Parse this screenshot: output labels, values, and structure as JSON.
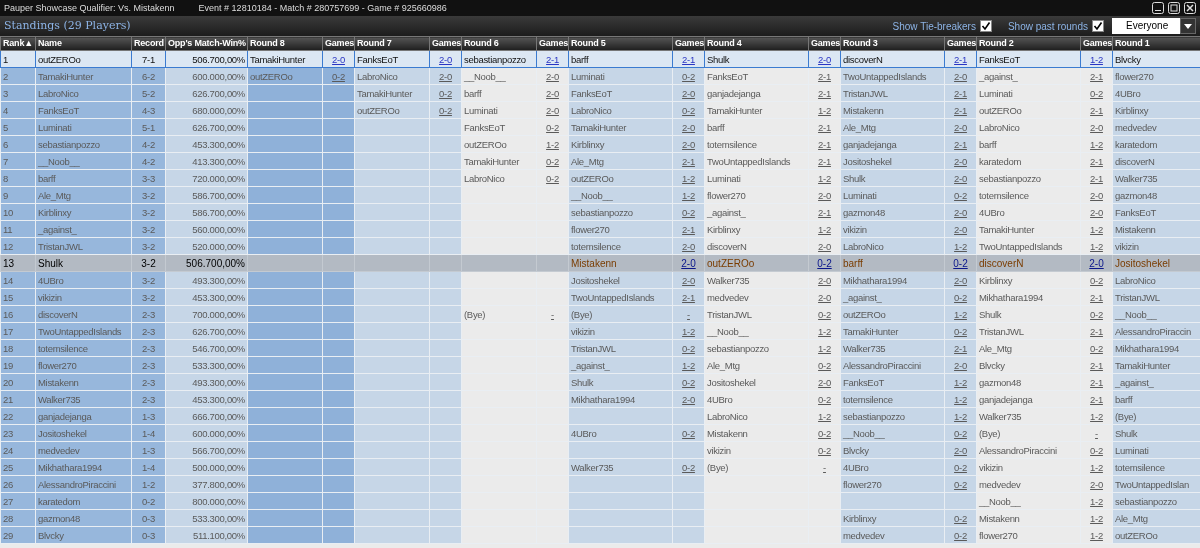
{
  "window": {
    "title": "Pauper Showcase Qualifier: Vs. Mistakenn",
    "subtitle": "Event # 12810184 - Match # 280757699 - Game # 925660986"
  },
  "standings": {
    "title": "Standings (29 Players)",
    "options": [
      {
        "label": "Show Tie-breakers",
        "checked": true
      },
      {
        "label": "Show past rounds",
        "checked": true
      }
    ],
    "filter": "Everyone"
  },
  "columns": [
    {
      "label": "Rank",
      "sort_mark": "▲"
    },
    {
      "label": "Name"
    },
    {
      "label": "Record"
    },
    {
      "label": "Opp's Match-Win%"
    },
    {
      "label": "Round 8"
    },
    {
      "label": "Games"
    },
    {
      "label": "Round 7"
    },
    {
      "label": "Games"
    },
    {
      "label": "Round 6"
    },
    {
      "label": "Games"
    },
    {
      "label": "Round 5"
    },
    {
      "label": "Games"
    },
    {
      "label": "Round 4"
    },
    {
      "label": "Games"
    },
    {
      "label": "Round 3"
    },
    {
      "label": "Games"
    },
    {
      "label": "Round 2"
    },
    {
      "label": "Games"
    },
    {
      "label": "Round 1"
    }
  ],
  "rows": [
    {
      "rank": "1",
      "name": "outZEROo",
      "record": "7-1",
      "omw": "506.700,00%",
      "selected": false,
      "outlined": true,
      "rounds": {
        "round_8": {
          "opponent": "TamakiHunter",
          "games": "2-0"
        },
        "round_7": {
          "opponent": "FanksEoT",
          "games": "2-0"
        },
        "round_6": {
          "opponent": "sebastianpozzo",
          "games": "2-1"
        },
        "round_5": {
          "opponent": "barff",
          "games": "2-1"
        },
        "round_4": {
          "opponent": "Shulk",
          "games": "2-0"
        },
        "round_3": {
          "opponent": "discoverN",
          "games": "2-1"
        },
        "round_2": {
          "opponent": "FanksEoT",
          "games": "1-2"
        },
        "round_1": {
          "opponent": "Blvcky"
        }
      }
    },
    {
      "rank": "2",
      "name": "TamakiHunter",
      "record": "6-2",
      "omw": "600.000,00%",
      "selected": false,
      "outlined": false,
      "rounds": {
        "round_8": {
          "opponent": "outZEROo",
          "games": "0-2"
        },
        "round_7": {
          "opponent": "LabroNico",
          "games": "2-0"
        },
        "round_6": {
          "opponent": "__Noob__",
          "games": "2-0"
        },
        "round_5": {
          "opponent": "Luminati",
          "games": "0-2"
        },
        "round_4": {
          "opponent": "FanksEoT",
          "games": "2-1"
        },
        "round_3": {
          "opponent": "TwoUntappedIslands",
          "games": "2-0"
        },
        "round_2": {
          "opponent": "_against_",
          "games": "2-1"
        },
        "round_1": {
          "opponent": "flower270"
        }
      }
    },
    {
      "rank": "3",
      "name": "LabroNico",
      "record": "5-2",
      "omw": "626.700,00%",
      "selected": false,
      "outlined": false,
      "rounds": {
        "round_7": {
          "opponent": "TamakiHunter",
          "games": "0-2"
        },
        "round_6": {
          "opponent": "barff",
          "games": "2-0"
        },
        "round_5": {
          "opponent": "FanksEoT",
          "games": "2-0"
        },
        "round_4": {
          "opponent": "ganjadejanga",
          "games": "2-1"
        },
        "round_3": {
          "opponent": "TristanJWL",
          "games": "2-1"
        },
        "round_2": {
          "opponent": "Luminati",
          "games": "0-2"
        },
        "round_1": {
          "opponent": "4UBro"
        }
      }
    },
    {
      "rank": "4",
      "name": "FanksEoT",
      "record": "4-3",
      "omw": "680.000,00%",
      "selected": false,
      "outlined": false,
      "rounds": {
        "round_7": {
          "opponent": "outZEROo",
          "games": "0-2"
        },
        "round_6": {
          "opponent": "Luminati",
          "games": "2-0"
        },
        "round_5": {
          "opponent": "LabroNico",
          "games": "0-2"
        },
        "round_4": {
          "opponent": "TamakiHunter",
          "games": "1-2"
        },
        "round_3": {
          "opponent": "Mistakenn",
          "games": "2-1"
        },
        "round_2": {
          "opponent": "outZEROo",
          "games": "2-1"
        },
        "round_1": {
          "opponent": "Kirblinxy"
        }
      }
    },
    {
      "rank": "5",
      "name": "Luminati",
      "record": "5-1",
      "omw": "626.700,00%",
      "selected": false,
      "outlined": false,
      "rounds": {
        "round_6": {
          "opponent": "FanksEoT",
          "games": "0-2"
        },
        "round_5": {
          "opponent": "TamakiHunter",
          "games": "2-0"
        },
        "round_4": {
          "opponent": "barff",
          "games": "2-1"
        },
        "round_3": {
          "opponent": "Ale_Mtg",
          "games": "2-0"
        },
        "round_2": {
          "opponent": "LabroNico",
          "games": "2-0"
        },
        "round_1": {
          "opponent": "medvedev"
        }
      }
    },
    {
      "rank": "6",
      "name": "sebastianpozzo",
      "record": "4-2",
      "omw": "453.300,00%",
      "selected": false,
      "outlined": false,
      "rounds": {
        "round_6": {
          "opponent": "outZEROo",
          "games": "1-2"
        },
        "round_5": {
          "opponent": "Kirblinxy",
          "games": "2-0"
        },
        "round_4": {
          "opponent": "totemsilence",
          "games": "2-1"
        },
        "round_3": {
          "opponent": "ganjadejanga",
          "games": "2-1"
        },
        "round_2": {
          "opponent": "barff",
          "games": "1-2"
        },
        "round_1": {
          "opponent": "karatedom"
        }
      }
    },
    {
      "rank": "7",
      "name": "__Noob__",
      "record": "4-2",
      "omw": "413.300,00%",
      "selected": false,
      "outlined": false,
      "rounds": {
        "round_6": {
          "opponent": "TamakiHunter",
          "games": "0-2"
        },
        "round_5": {
          "opponent": "Ale_Mtg",
          "games": "2-1"
        },
        "round_4": {
          "opponent": "TwoUntappedIslands",
          "games": "2-1"
        },
        "round_3": {
          "opponent": "Jositoshekel",
          "games": "2-0"
        },
        "round_2": {
          "opponent": "karatedom",
          "games": "2-1"
        },
        "round_1": {
          "opponent": "discoverN"
        }
      }
    },
    {
      "rank": "8",
      "name": "barff",
      "record": "3-3",
      "omw": "720.000,00%",
      "selected": false,
      "outlined": false,
      "rounds": {
        "round_6": {
          "opponent": "LabroNico",
          "games": "0-2"
        },
        "round_5": {
          "opponent": "outZEROo",
          "games": "1-2"
        },
        "round_4": {
          "opponent": "Luminati",
          "games": "1-2"
        },
        "round_3": {
          "opponent": "Shulk",
          "games": "2-0"
        },
        "round_2": {
          "opponent": "sebastianpozzo",
          "games": "2-1"
        },
        "round_1": {
          "opponent": "Walker735"
        }
      }
    },
    {
      "rank": "9",
      "name": "Ale_Mtg",
      "record": "3-2",
      "omw": "586.700,00%",
      "selected": false,
      "outlined": false,
      "rounds": {
        "round_5": {
          "opponent": "__Noob__",
          "games": "1-2"
        },
        "round_4": {
          "opponent": "flower270",
          "games": "2-0"
        },
        "round_3": {
          "opponent": "Luminati",
          "games": "0-2"
        },
        "round_2": {
          "opponent": "totemsilence",
          "games": "2-0"
        },
        "round_1": {
          "opponent": "gazmon48"
        }
      }
    },
    {
      "rank": "10",
      "name": "Kirblinxy",
      "record": "3-2",
      "omw": "586.700,00%",
      "selected": false,
      "outlined": false,
      "rounds": {
        "round_5": {
          "opponent": "sebastianpozzo",
          "games": "0-2"
        },
        "round_4": {
          "opponent": "_against_",
          "games": "2-1"
        },
        "round_3": {
          "opponent": "gazmon48",
          "games": "2-0"
        },
        "round_2": {
          "opponent": "4UBro",
          "games": "2-0"
        },
        "round_1": {
          "opponent": "FanksEoT"
        }
      }
    },
    {
      "rank": "11",
      "name": "_against_",
      "record": "3-2",
      "omw": "560.000,00%",
      "selected": false,
      "outlined": false,
      "rounds": {
        "round_5": {
          "opponent": "flower270",
          "games": "2-1"
        },
        "round_4": {
          "opponent": "Kirblinxy",
          "games": "1-2"
        },
        "round_3": {
          "opponent": "vikizin",
          "games": "2-0"
        },
        "round_2": {
          "opponent": "TamakiHunter",
          "games": "1-2"
        },
        "round_1": {
          "opponent": "Mistakenn"
        }
      }
    },
    {
      "rank": "12",
      "name": "TristanJWL",
      "record": "3-2",
      "omw": "520.000,00%",
      "selected": false,
      "outlined": false,
      "rounds": {
        "round_5": {
          "opponent": "totemsilence",
          "games": "2-0"
        },
        "round_4": {
          "opponent": "discoverN",
          "games": "2-0"
        },
        "round_3": {
          "opponent": "LabroNico",
          "games": "1-2"
        },
        "round_2": {
          "opponent": "TwoUntappedIslands",
          "games": "1-2"
        },
        "round_1": {
          "opponent": "vikizin"
        }
      }
    },
    {
      "rank": "13",
      "name": "Shulk",
      "record": "3-2",
      "omw": "506.700,00%",
      "selected": true,
      "outlined": false,
      "rounds": {
        "round_5": {
          "opponent": "Mistakenn",
          "games": "2-0"
        },
        "round_4": {
          "opponent": "outZEROo",
          "games": "0-2"
        },
        "round_3": {
          "opponent": "barff",
          "games": "0-2"
        },
        "round_2": {
          "opponent": "discoverN",
          "games": "2-0"
        },
        "round_1": {
          "opponent": "Jositoshekel"
        }
      }
    },
    {
      "rank": "14",
      "name": "4UBro",
      "record": "3-2",
      "omw": "493.300,00%",
      "selected": false,
      "outlined": false,
      "rounds": {
        "round_5": {
          "opponent": "Jositoshekel",
          "games": "2-0"
        },
        "round_4": {
          "opponent": "Walker735",
          "games": "2-0"
        },
        "round_3": {
          "opponent": "Mikhathara1994",
          "games": "2-0"
        },
        "round_2": {
          "opponent": "Kirblinxy",
          "games": "0-2"
        },
        "round_1": {
          "opponent": "LabroNico"
        }
      }
    },
    {
      "rank": "15",
      "name": "vikizin",
      "record": "3-2",
      "omw": "453.300,00%",
      "selected": false,
      "outlined": false,
      "rounds": {
        "round_5": {
          "opponent": "TwoUntappedIslands",
          "games": "2-1"
        },
        "round_4": {
          "opponent": "medvedev",
          "games": "2-0"
        },
        "round_3": {
          "opponent": "_against_",
          "games": "0-2"
        },
        "round_2": {
          "opponent": "Mikhathara1994",
          "games": "2-1"
        },
        "round_1": {
          "opponent": "TristanJWL"
        }
      }
    },
    {
      "rank": "16",
      "name": "discoverN",
      "record": "2-3",
      "omw": "700.000,00%",
      "selected": false,
      "outlined": false,
      "rounds": {
        "round_6": {
          "opponent": "(Bye)",
          "games": "-"
        },
        "round_5": {
          "opponent": "(Bye)",
          "games": "-"
        },
        "round_4": {
          "opponent": "TristanJWL",
          "games": "0-2"
        },
        "round_3": {
          "opponent": "outZEROo",
          "games": "1-2"
        },
        "round_2": {
          "opponent": "Shulk",
          "games": "0-2"
        },
        "round_1": {
          "opponent": "__Noob__"
        }
      }
    },
    {
      "rank": "17",
      "name": "TwoUntappedIslands",
      "record": "2-3",
      "omw": "626.700,00%",
      "selected": false,
      "outlined": false,
      "rounds": {
        "round_5": {
          "opponent": "vikizin",
          "games": "1-2"
        },
        "round_4": {
          "opponent": "__Noob__",
          "games": "1-2"
        },
        "round_3": {
          "opponent": "TamakiHunter",
          "games": "0-2"
        },
        "round_2": {
          "opponent": "TristanJWL",
          "games": "2-1"
        },
        "round_1": {
          "opponent": "AlessandroPiraccin"
        }
      }
    },
    {
      "rank": "18",
      "name": "totemsilence",
      "record": "2-3",
      "omw": "546.700,00%",
      "selected": false,
      "outlined": false,
      "rounds": {
        "round_5": {
          "opponent": "TristanJWL",
          "games": "0-2"
        },
        "round_4": {
          "opponent": "sebastianpozzo",
          "games": "1-2"
        },
        "round_3": {
          "opponent": "Walker735",
          "games": "2-1"
        },
        "round_2": {
          "opponent": "Ale_Mtg",
          "games": "0-2"
        },
        "round_1": {
          "opponent": "Mikhathara1994"
        }
      }
    },
    {
      "rank": "19",
      "name": "flower270",
      "record": "2-3",
      "omw": "533.300,00%",
      "selected": false,
      "outlined": false,
      "rounds": {
        "round_5": {
          "opponent": "_against_",
          "games": "1-2"
        },
        "round_4": {
          "opponent": "Ale_Mtg",
          "games": "0-2"
        },
        "round_3": {
          "opponent": "AlessandroPiraccini",
          "games": "2-0"
        },
        "round_2": {
          "opponent": "Blvcky",
          "games": "2-1"
        },
        "round_1": {
          "opponent": "TamakiHunter"
        }
      }
    },
    {
      "rank": "20",
      "name": "Mistakenn",
      "record": "2-3",
      "omw": "493.300,00%",
      "selected": false,
      "outlined": false,
      "rounds": {
        "round_5": {
          "opponent": "Shulk",
          "games": "0-2"
        },
        "round_4": {
          "opponent": "Jositoshekel",
          "games": "2-0"
        },
        "round_3": {
          "opponent": "FanksEoT",
          "games": "1-2"
        },
        "round_2": {
          "opponent": "gazmon48",
          "games": "2-1"
        },
        "round_1": {
          "opponent": "_against_"
        }
      }
    },
    {
      "rank": "21",
      "name": "Walker735",
      "record": "2-3",
      "omw": "453.300,00%",
      "selected": false,
      "outlined": false,
      "rounds": {
        "round_5": {
          "opponent": "Mikhathara1994",
          "games": "2-0"
        },
        "round_4": {
          "opponent": "4UBro",
          "games": "0-2"
        },
        "round_3": {
          "opponent": "totemsilence",
          "games": "1-2"
        },
        "round_2": {
          "opponent": "ganjadejanga",
          "games": "2-1"
        },
        "round_1": {
          "opponent": "barff"
        }
      }
    },
    {
      "rank": "22",
      "name": "ganjadejanga",
      "record": "1-3",
      "omw": "666.700,00%",
      "selected": false,
      "outlined": false,
      "rounds": {
        "round_4": {
          "opponent": "LabroNico",
          "games": "1-2"
        },
        "round_3": {
          "opponent": "sebastianpozzo",
          "games": "1-2"
        },
        "round_2": {
          "opponent": "Walker735",
          "games": "1-2"
        },
        "round_1": {
          "opponent": "(Bye)"
        }
      }
    },
    {
      "rank": "23",
      "name": "Jositoshekel",
      "record": "1-4",
      "omw": "600.000,00%",
      "selected": false,
      "outlined": false,
      "rounds": {
        "round_5": {
          "opponent": "4UBro",
          "games": "0-2"
        },
        "round_4": {
          "opponent": "Mistakenn",
          "games": "0-2"
        },
        "round_3": {
          "opponent": "__Noob__",
          "games": "0-2"
        },
        "round_2": {
          "opponent": "(Bye)",
          "games": "-"
        },
        "round_1": {
          "opponent": "Shulk"
        }
      }
    },
    {
      "rank": "24",
      "name": "medvedev",
      "record": "1-3",
      "omw": "566.700,00%",
      "selected": false,
      "outlined": false,
      "rounds": {
        "round_4": {
          "opponent": "vikizin",
          "games": "0-2"
        },
        "round_3": {
          "opponent": "Blvcky",
          "games": "2-0"
        },
        "round_2": {
          "opponent": "AlessandroPiraccini",
          "games": "0-2"
        },
        "round_1": {
          "opponent": "Luminati"
        }
      }
    },
    {
      "rank": "25",
      "name": "Mikhathara1994",
      "record": "1-4",
      "omw": "500.000,00%",
      "selected": false,
      "outlined": false,
      "rounds": {
        "round_5": {
          "opponent": "Walker735",
          "games": "0-2"
        },
        "round_4": {
          "opponent": "(Bye)",
          "games": "-"
        },
        "round_3": {
          "opponent": "4UBro",
          "games": "0-2"
        },
        "round_2": {
          "opponent": "vikizin",
          "games": "1-2"
        },
        "round_1": {
          "opponent": "totemsilence"
        }
      }
    },
    {
      "rank": "26",
      "name": "AlessandroPiraccini",
      "record": "1-2",
      "omw": "377.800,00%",
      "selected": false,
      "outlined": false,
      "rounds": {
        "round_3": {
          "opponent": "flower270",
          "games": "0-2"
        },
        "round_2": {
          "opponent": "medvedev",
          "games": "2-0"
        },
        "round_1": {
          "opponent": "TwoUntappedIslan"
        }
      }
    },
    {
      "rank": "27",
      "name": "karatedom",
      "record": "0-2",
      "omw": "800.000,00%",
      "selected": false,
      "outlined": false,
      "rounds": {
        "round_2": {
          "opponent": "__Noob__",
          "games": "1-2"
        },
        "round_1": {
          "opponent": "sebastianpozzo"
        }
      }
    },
    {
      "rank": "28",
      "name": "gazmon48",
      "record": "0-3",
      "omw": "533.300,00%",
      "selected": false,
      "outlined": false,
      "rounds": {
        "round_3": {
          "opponent": "Kirblinxy",
          "games": "0-2"
        },
        "round_2": {
          "opponent": "Mistakenn",
          "games": "1-2"
        },
        "round_1": {
          "opponent": "Ale_Mtg"
        }
      }
    },
    {
      "rank": "29",
      "name": "Blvcky",
      "record": "0-3",
      "omw": "511.100,00%",
      "selected": false,
      "outlined": false,
      "rounds": {
        "round_3": {
          "opponent": "medvedev",
          "games": "0-2"
        },
        "round_2": {
          "opponent": "flower270",
          "games": "1-2"
        },
        "round_1": {
          "opponent": "outZEROo"
        }
      }
    }
  ]
}
